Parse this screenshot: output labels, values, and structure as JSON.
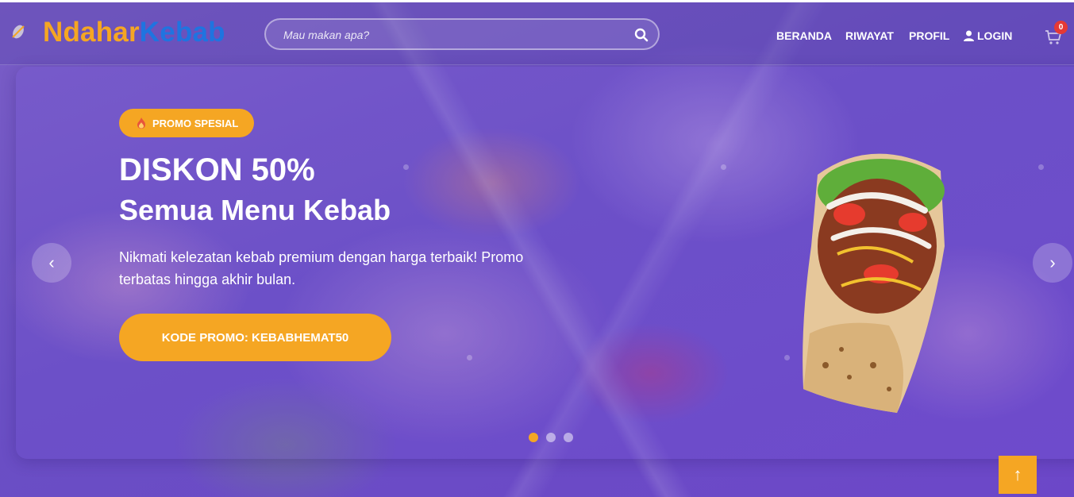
{
  "brand": {
    "name_part1": "Ndahar",
    "name_part2": "Kebab",
    "color_primary": "#f5a623",
    "color_secondary": "#1f74e0"
  },
  "search": {
    "placeholder": "Mau makan apa?",
    "value": ""
  },
  "nav": {
    "items": [
      "BERANDA",
      "RIWAYAT",
      "PROFIL"
    ],
    "login": "LOGIN"
  },
  "cart": {
    "count": "0"
  },
  "hero": {
    "badge": "PROMO SPESIAL",
    "title": "DISKON 50%",
    "subtitle": "Semua Menu Kebab",
    "description": "Nikmati kelezatan kebab premium dengan harga terbaik! Promo terbatas hingga akhir bulan.",
    "cta": "KODE PROMO: KEBABHEMAT50",
    "prev": "‹",
    "next": "›"
  },
  "carousel": {
    "slides": 3,
    "active": 0
  },
  "back_to_top": "↑"
}
